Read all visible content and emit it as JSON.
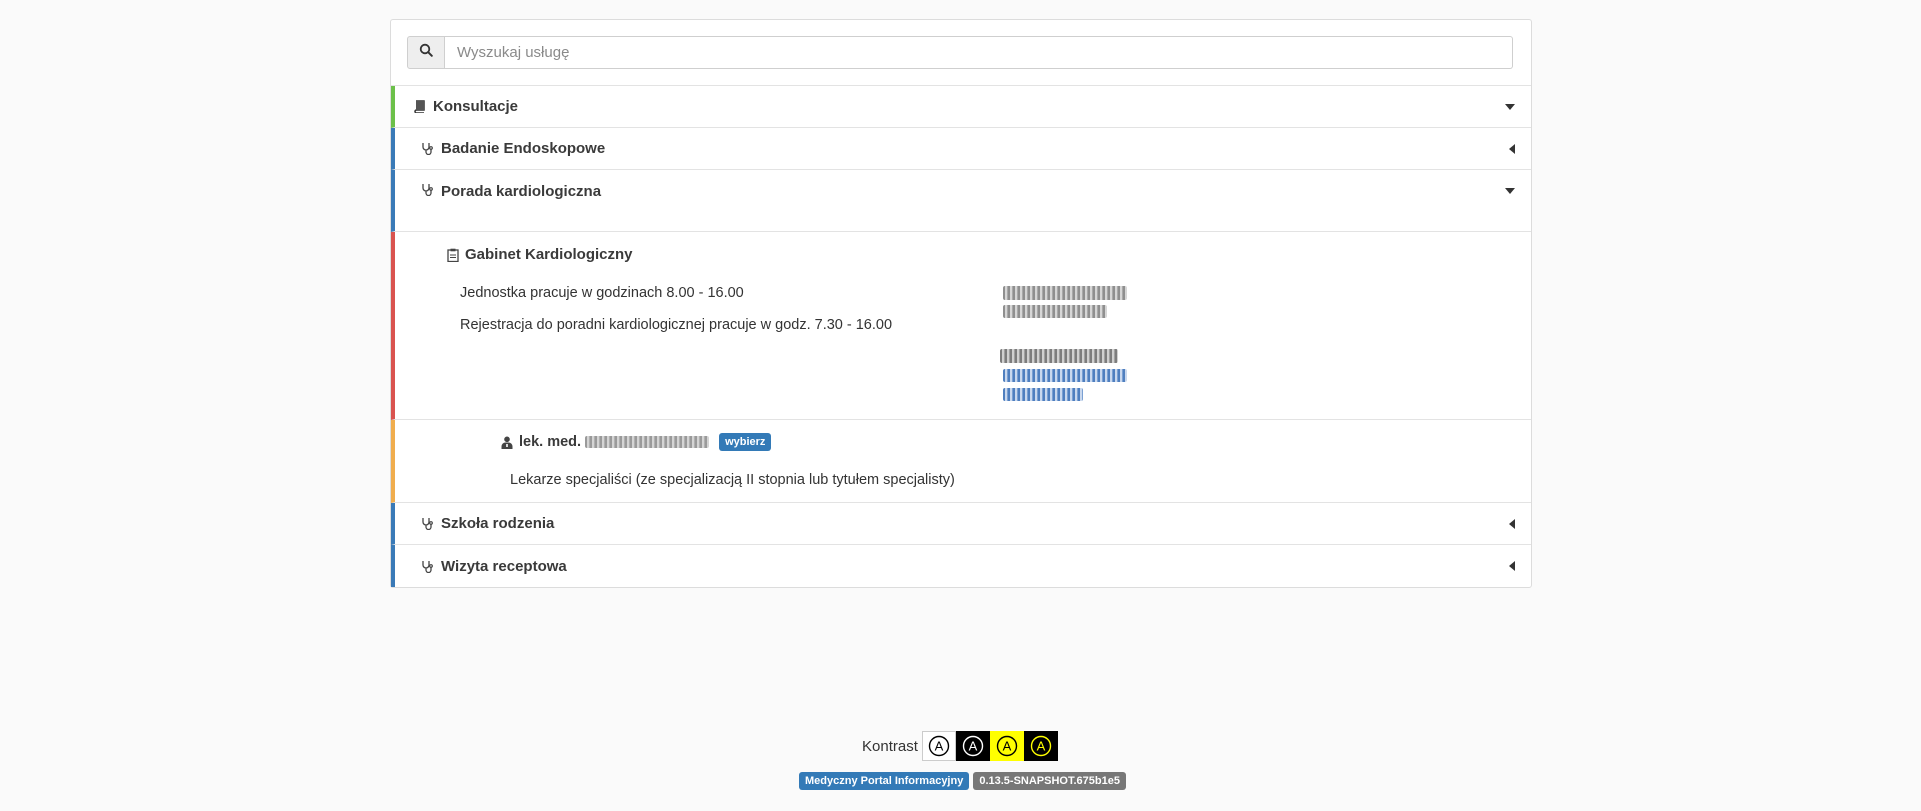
{
  "search": {
    "placeholder": "Wyszukaj usługę",
    "icon": "search-icon"
  },
  "category": {
    "label": "Konsultacje",
    "icon": "book-icon",
    "accent": "#6cc04a"
  },
  "services": {
    "endoskopowe": {
      "label": "Badanie Endoskopowe",
      "icon": "stethoscope-icon"
    },
    "kardio": {
      "label": "Porada kardiologiczna",
      "icon": "stethoscope-icon"
    },
    "szkola": {
      "label": "Szkoła rodzenia",
      "icon": "stethoscope-icon"
    },
    "recepta": {
      "label": "Wizyta receptowa",
      "icon": "stethoscope-icon"
    }
  },
  "unit": {
    "title": "Gabinet Kardiologiczny",
    "icon": "clipboard-icon",
    "hours": "Jednostka pracuje w godzinach 8.00 - 16.00",
    "registration": "Rejestracja do poradni kardiologicznej pracuje w godz. 7.30 - 16.00",
    "accent": "#d9534f"
  },
  "doctor": {
    "prefix": "lek. med.",
    "choose_label": "wybierz",
    "description": "Lekarze specjaliści (ze specjalizacją II stopnia lub tytułem specjalisty)",
    "icon": "doctor-icon",
    "accent": "#f0ad4e"
  },
  "footer": {
    "contrast_label": "Kontrast",
    "contrast_options": [
      "A",
      "A",
      "A",
      "A"
    ],
    "app_name": "Medyczny Portal Informacyjny",
    "version": "0.13.5-SNAPSHOT.675b1e5"
  },
  "colors": {
    "primary": "#337ab7",
    "version_badge": "#777777",
    "contrast_yellow": "#ffff00"
  }
}
